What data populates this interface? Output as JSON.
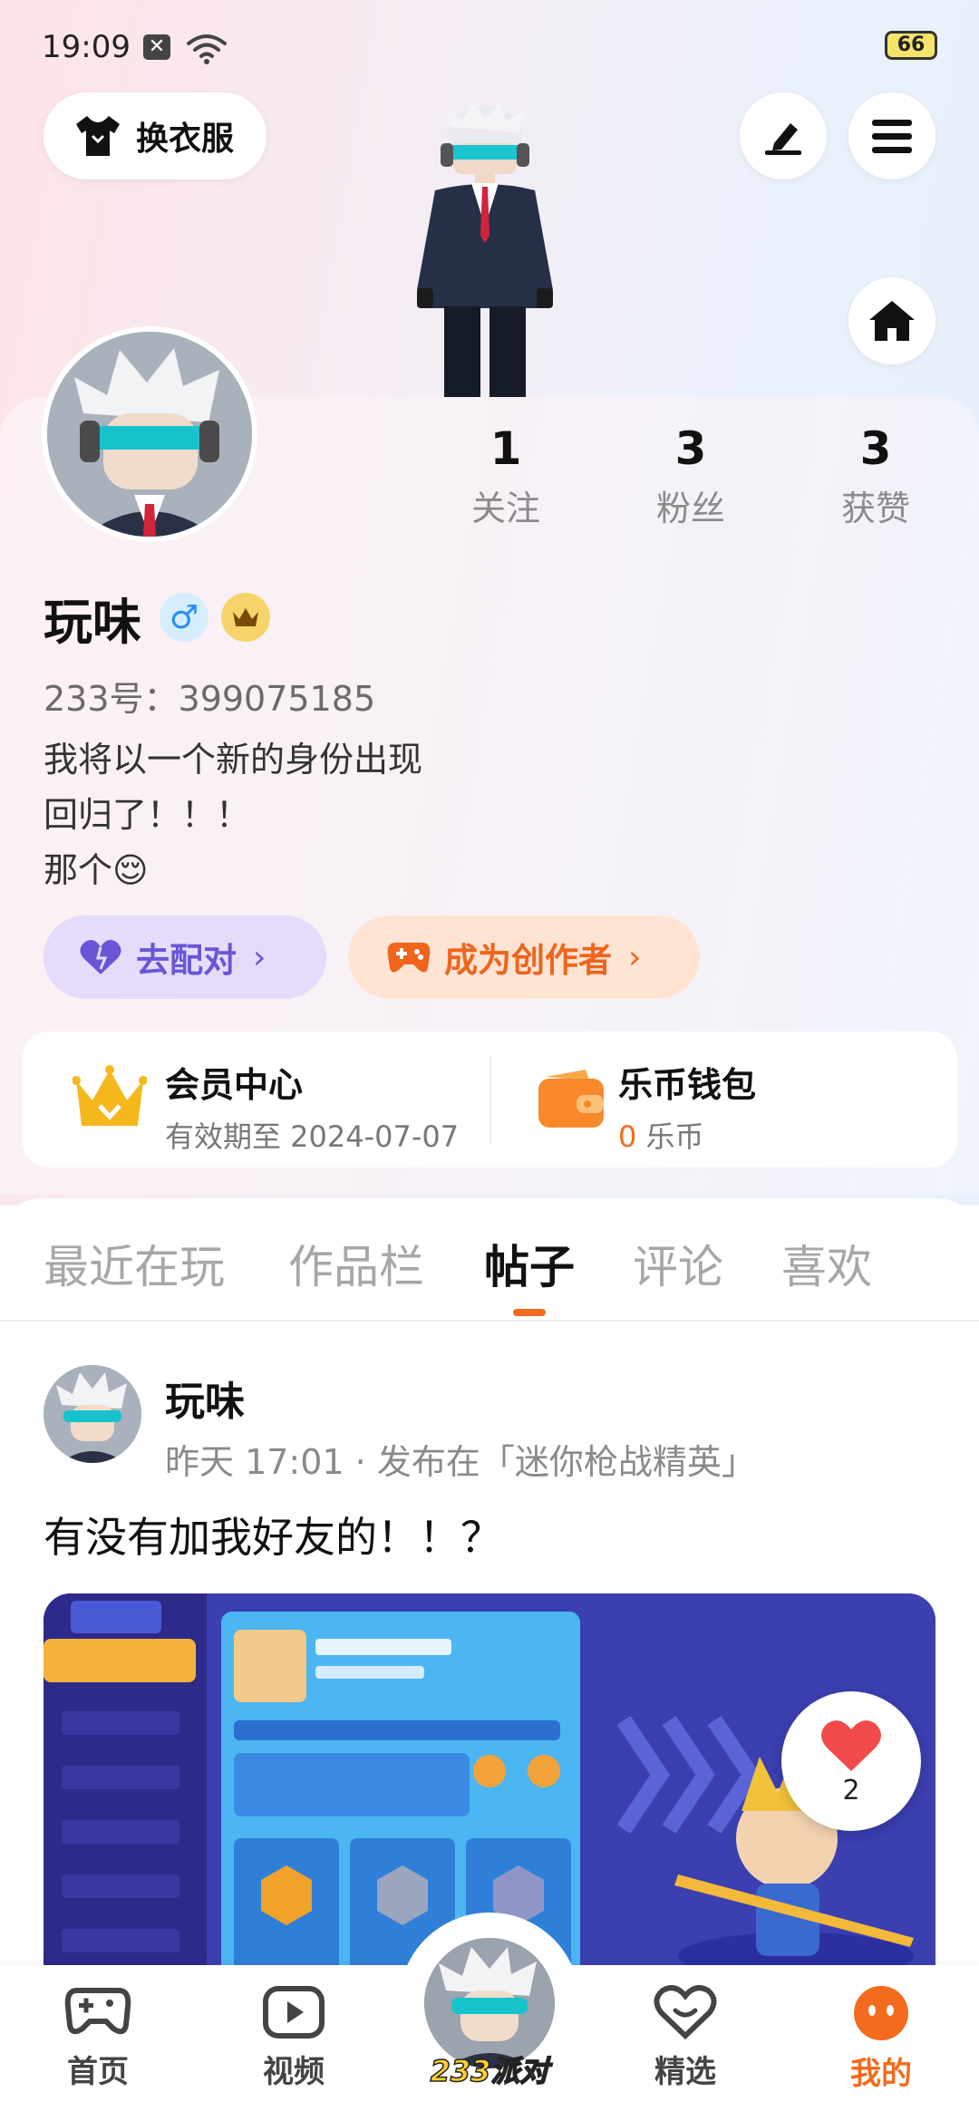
{
  "status_bar": {
    "time": "19:09",
    "battery": "66"
  },
  "header": {
    "outfit_button": "换衣服"
  },
  "profile": {
    "stats": [
      {
        "count": "1",
        "label": "关注"
      },
      {
        "count": "3",
        "label": "粉丝"
      },
      {
        "count": "3",
        "label": "获赞"
      }
    ],
    "name": "玩味",
    "gender_symbol": "♂",
    "uid": "233号：399075185",
    "bio_lines": [
      "我将以一个新的身份出现",
      "回归了！！！",
      "那个😌"
    ],
    "pair_button": "去配对",
    "creator_button": "成为创作者",
    "vip_center": {
      "title": "会员中心",
      "subtitle": "有效期至 2024-07-07"
    },
    "wallet": {
      "title": "乐币钱包",
      "amount": "0",
      "unit": "乐币"
    }
  },
  "tabs": [
    "最近在玩",
    "作品栏",
    "帖子",
    "评论",
    "喜欢"
  ],
  "active_tab": "帖子",
  "post": {
    "author": "玩味",
    "meta": "昨天 17:01 · 发布在「迷你枪战精英」",
    "text": "有没有加我好友的！！？",
    "likes": "2"
  },
  "bottom_nav": {
    "items": [
      "首页",
      "视频",
      "精选",
      "我的"
    ],
    "center_brand": "233派对",
    "active": "我的"
  },
  "colors": {
    "accent": "#f36b1c",
    "pair_purple": "#6b55d6",
    "creator_orange": "#f0641c"
  }
}
